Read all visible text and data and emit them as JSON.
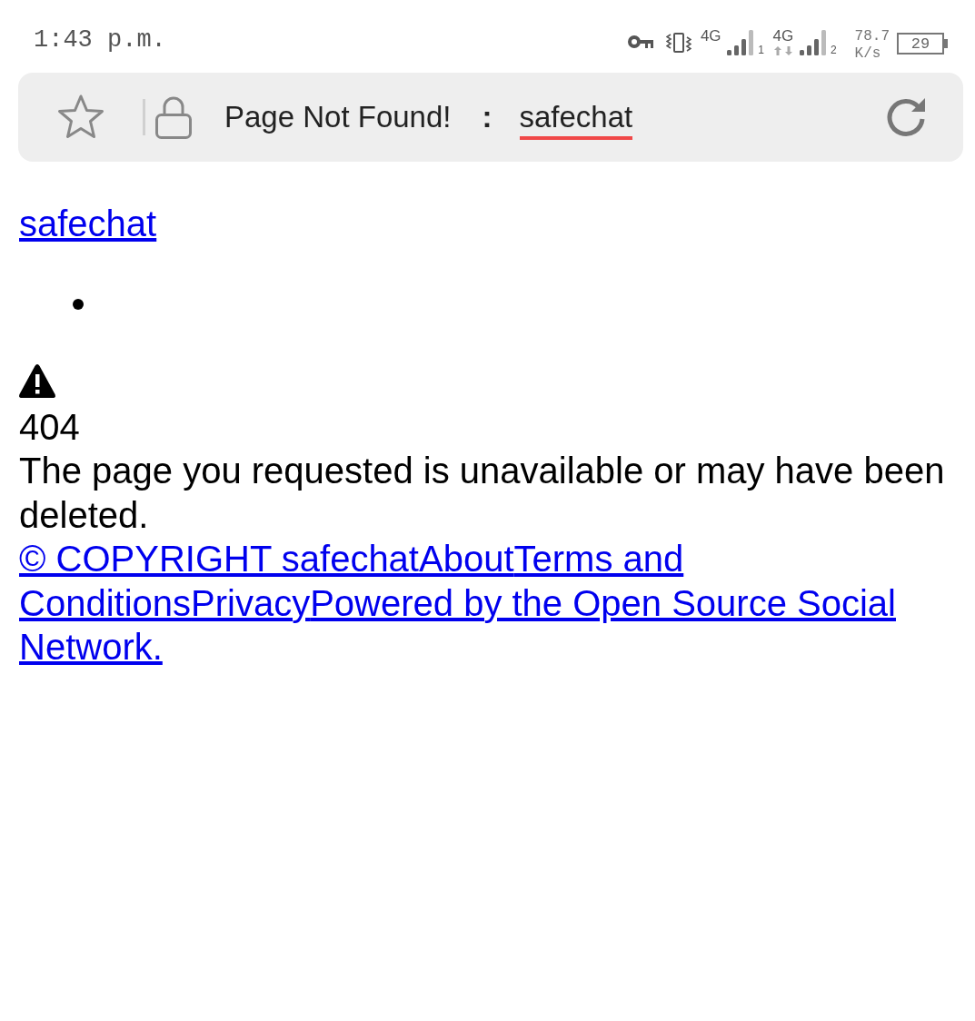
{
  "status_bar": {
    "time": "1:43 p.m.",
    "sims": [
      {
        "network": "4G",
        "slot": "1",
        "data_active": false
      },
      {
        "network": "4G",
        "slot": "2",
        "data_active": true
      }
    ],
    "speed": "78.7",
    "speed_unit": "K/s",
    "battery": "29"
  },
  "address_bar": {
    "bookmarked": false,
    "title": "Page Not Found!",
    "separator": ":",
    "site": "safechat"
  },
  "page": {
    "site_link": "safechat",
    "error_code": "404",
    "message": "The page you requested is unavailable or may have been deleted.",
    "footer_links": [
      "© COPYRIGHT safechat",
      "About",
      "Terms and Conditions",
      "Privacy",
      "Powered by the Open Source Social Network."
    ]
  }
}
